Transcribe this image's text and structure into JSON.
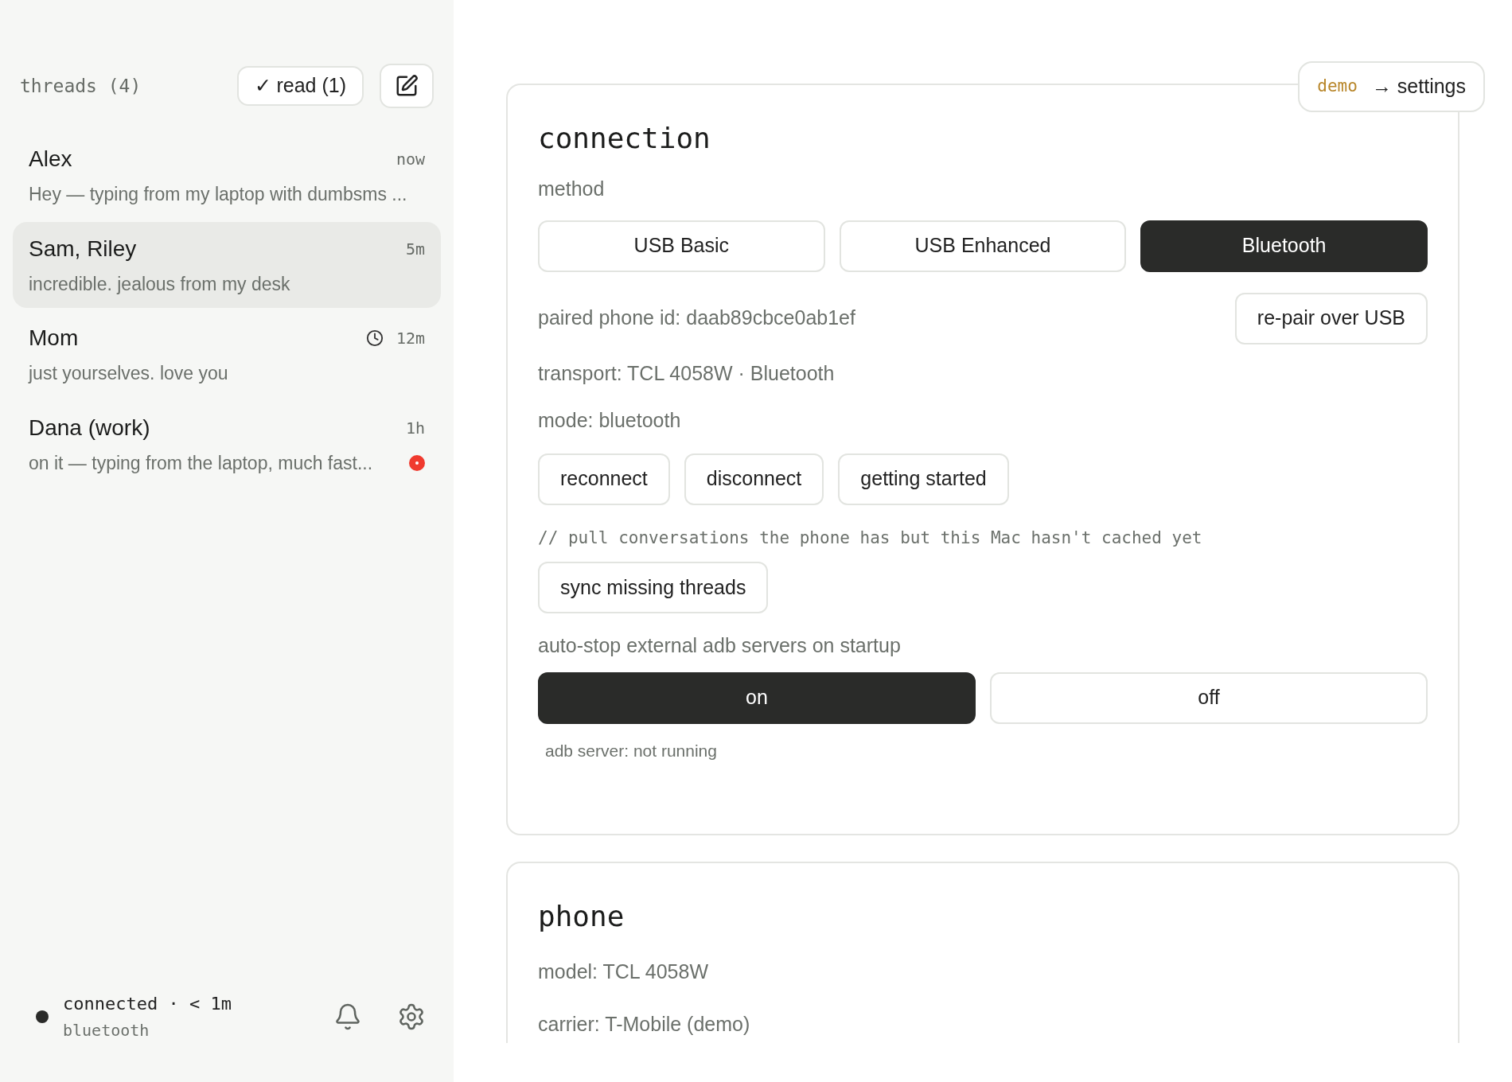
{
  "sidebar": {
    "title": "threads (4)",
    "mark_read_button": "✓ read (1)",
    "threads": [
      {
        "name": "Alex",
        "time": "now",
        "preview": "Hey — typing from my laptop with dumbsms ...",
        "selected": false,
        "scheduled": false,
        "unread": false
      },
      {
        "name": "Sam, Riley",
        "time": "5m",
        "preview": "incredible. jealous from my desk",
        "selected": true,
        "scheduled": false,
        "unread": false
      },
      {
        "name": "Mom",
        "time": "12m",
        "preview": "just yourselves. love you",
        "selected": false,
        "scheduled": true,
        "unread": false
      },
      {
        "name": "Dana (work)",
        "time": "1h",
        "preview": "on it — typing from the laptop, much fast...",
        "selected": false,
        "scheduled": false,
        "unread": true
      }
    ],
    "status": {
      "line": "connected · < 1m",
      "transport": "bluetooth"
    }
  },
  "demo_badge": {
    "tag": "demo",
    "link": "→ settings"
  },
  "connection": {
    "title": "connection",
    "method_label": "method",
    "methods": [
      {
        "label": "USB Basic",
        "selected": false
      },
      {
        "label": "USB Enhanced",
        "selected": false
      },
      {
        "label": "Bluetooth",
        "selected": true
      }
    ],
    "paired_id": "paired phone id: daab89cbce0ab1ef",
    "repair_button": "re-pair over USB",
    "transport": "transport: TCL 4058W · Bluetooth",
    "mode": "mode: bluetooth",
    "actions": [
      "reconnect",
      "disconnect",
      "getting started"
    ],
    "sync_comment": "// pull conversations the phone has but this Mac hasn't cached yet",
    "sync_button": "sync missing threads",
    "autostop_label": "auto-stop external adb servers on startup",
    "autostop_options": [
      {
        "label": "on",
        "selected": true
      },
      {
        "label": "off",
        "selected": false
      }
    ],
    "adb_status": "adb server: not running"
  },
  "phone": {
    "title": "phone",
    "model": "model: TCL 4058W",
    "carrier": "carrier: T-Mobile (demo)"
  }
}
